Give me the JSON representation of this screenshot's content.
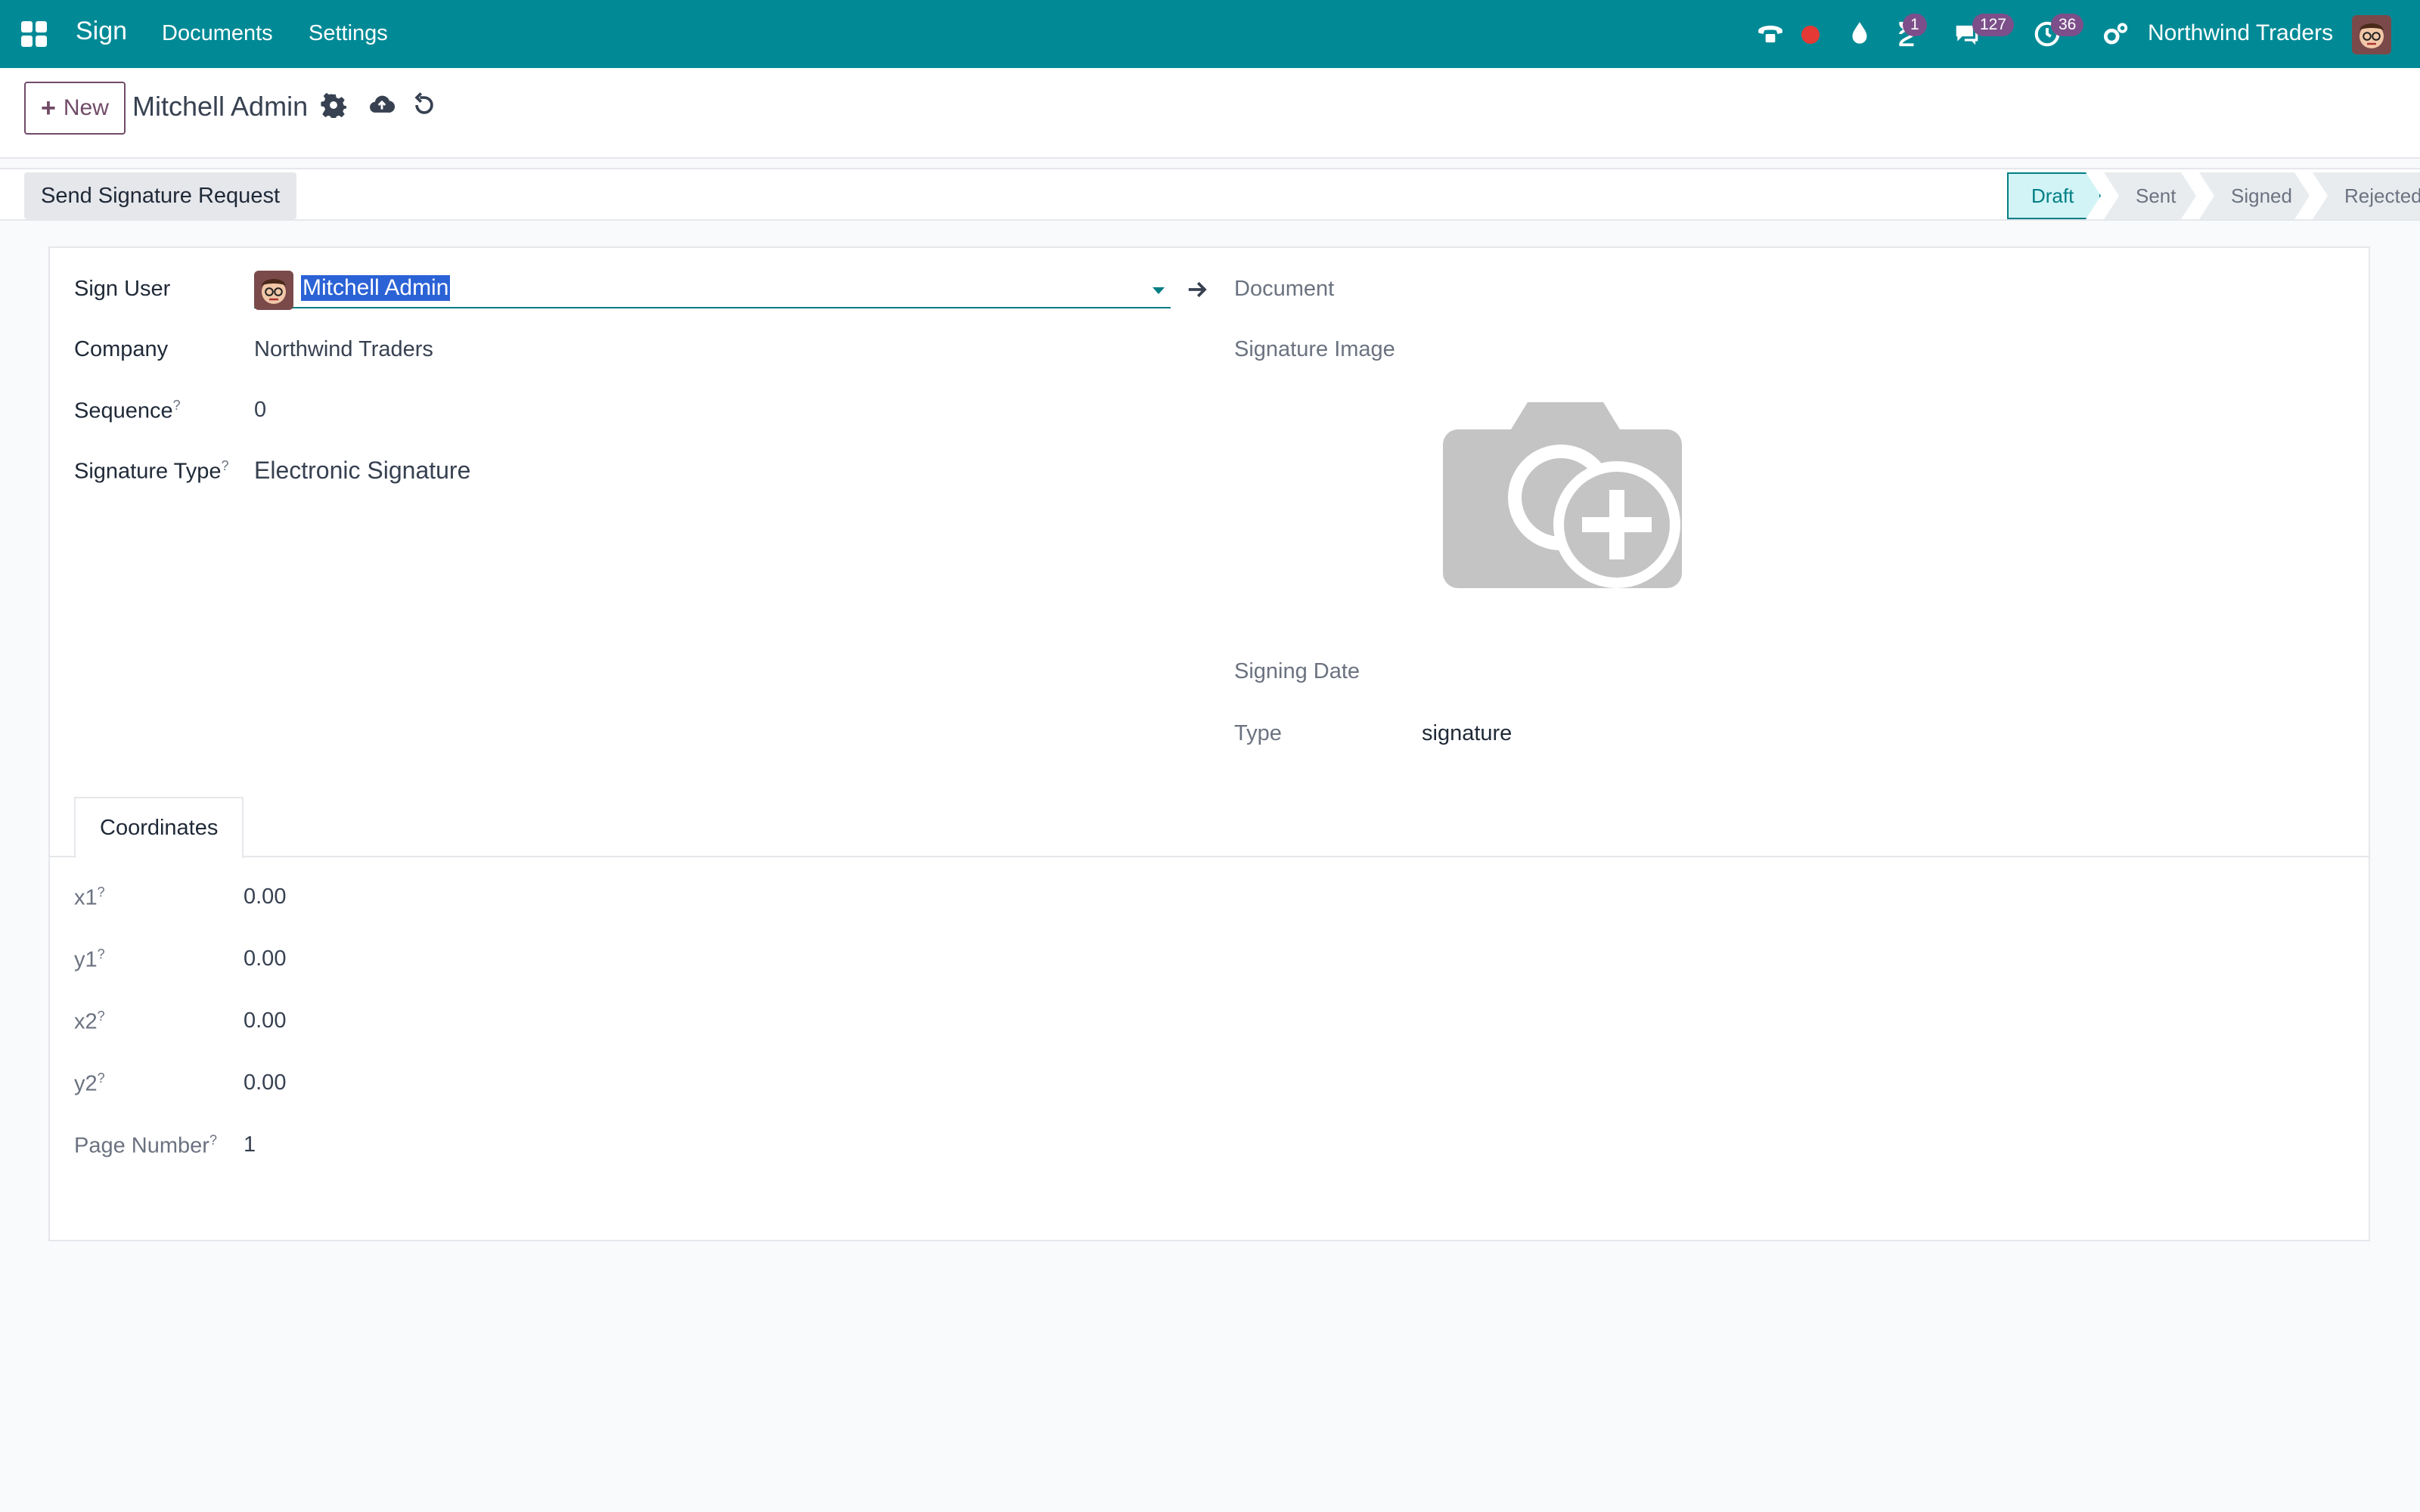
{
  "navbar": {
    "app_name": "Sign",
    "menus": [
      "Documents",
      "Settings"
    ],
    "activity_badge": "1",
    "messages_badge": "127",
    "clock_badge": "36",
    "company": "Northwind Traders",
    "colors": {
      "bar": "#018a96",
      "badge": "#7c4f8a",
      "record_dot": "#e53935"
    }
  },
  "control_panel": {
    "new_label": "New",
    "record_title": "Mitchell Admin"
  },
  "statusbar": {
    "send_label": "Send Signature Request",
    "stages": [
      "Draft",
      "Sent",
      "Signed",
      "Rejected"
    ],
    "active_stage": "Draft"
  },
  "form": {
    "sign_user": {
      "label": "Sign User",
      "value": "Mitchell Admin"
    },
    "company": {
      "label": "Company",
      "value": "Northwind Traders"
    },
    "sequence": {
      "label": "Sequence",
      "help": "?",
      "value": "0"
    },
    "signature_type": {
      "label": "Signature Type",
      "help": "?",
      "value": "Electronic Signature"
    },
    "document": {
      "label": "Document"
    },
    "signature_image": {
      "label": "Signature Image"
    },
    "signing_date": {
      "label": "Signing Date"
    },
    "type": {
      "label": "Type",
      "value": "signature"
    }
  },
  "notebook": {
    "tab_label": "Coordinates",
    "fields": {
      "x1": {
        "label": "x1",
        "help": "?",
        "value": "0.00"
      },
      "y1": {
        "label": "y1",
        "help": "?",
        "value": "0.00"
      },
      "x2": {
        "label": "x2",
        "help": "?",
        "value": "0.00"
      },
      "y2": {
        "label": "y2",
        "help": "?",
        "value": "0.00"
      },
      "page_number": {
        "label": "Page Number",
        "help": "?",
        "value": "1"
      }
    }
  }
}
